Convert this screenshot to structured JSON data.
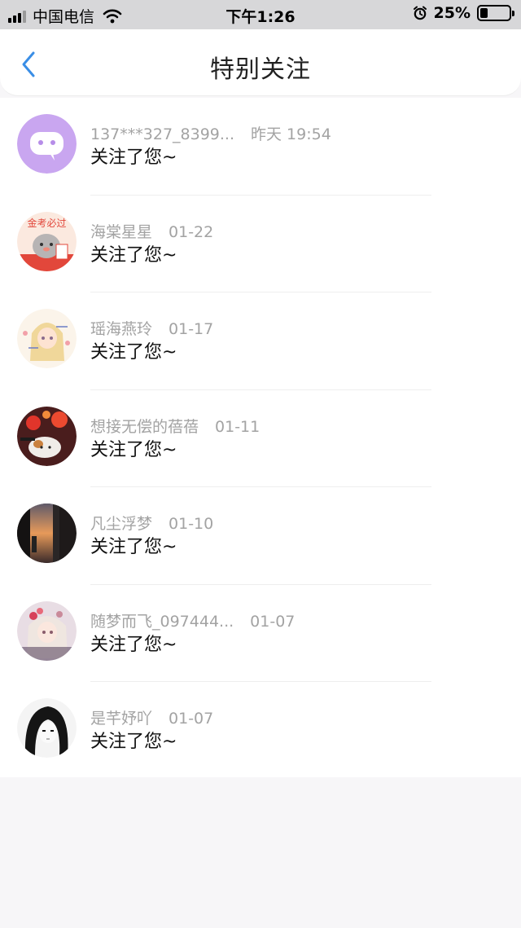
{
  "status_bar": {
    "carrier": "中国电信",
    "time": "下午1:26",
    "battery": "25%",
    "battery_level": 0.25,
    "icons": [
      "signal-icon",
      "wifi-icon",
      "alarm-icon",
      "battery-icon"
    ]
  },
  "header": {
    "title": "特别关注",
    "back_icon": "chevron-left-icon",
    "accent_color": "#3a8ee6"
  },
  "items": [
    {
      "name": "137***327_8399...",
      "time": "昨天 19:54",
      "message": "关注了您~"
    },
    {
      "name": "海棠星星",
      "time": "01-22",
      "message": "关注了您~"
    },
    {
      "name": "瑶海燕玲",
      "time": "01-17",
      "message": "关注了您~"
    },
    {
      "name": "想接无偿的蓓蓓",
      "time": "01-11",
      "message": "关注了您~"
    },
    {
      "name": "凡尘浮梦",
      "time": "01-10",
      "message": "关注了您~"
    },
    {
      "name": "随梦而飞_097444...",
      "time": "01-07",
      "message": "关注了您~"
    },
    {
      "name": "是芊妤吖",
      "time": "01-07",
      "message": "关注了您~"
    }
  ],
  "avatar_stamp_text": "金考必过"
}
